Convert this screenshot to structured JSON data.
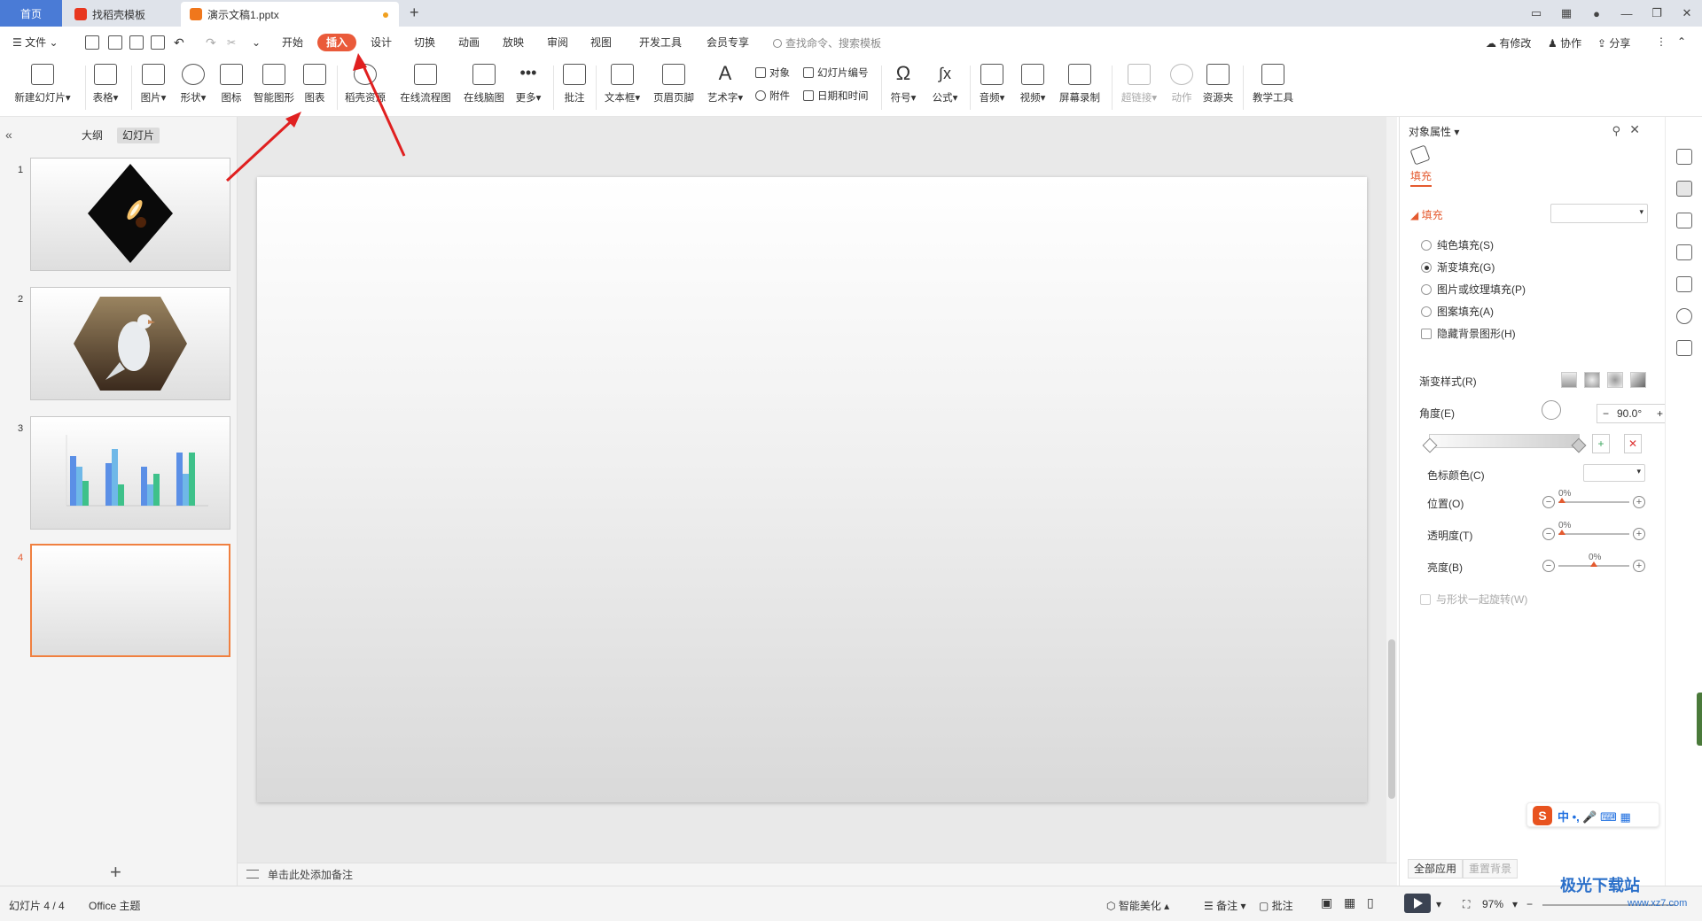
{
  "tabs": {
    "home": "首页",
    "template": "找稻壳模板",
    "doc": "演示文稿1.pptx",
    "new_tab": "+"
  },
  "menu": {
    "file": "文件",
    "items": [
      "开始",
      "插入",
      "设计",
      "切换",
      "动画",
      "放映",
      "审阅",
      "视图",
      "开发工具",
      "会员专享"
    ],
    "active_item": "插入",
    "search_placeholder": "查找命令、搜索模板",
    "changes": "有修改",
    "collab": "协作",
    "share": "分享"
  },
  "ribbon": {
    "new_slide": "新建幻灯片",
    "table": "表格",
    "picture": "图片",
    "shape": "形状",
    "icon": "图标",
    "smartart": "智能图形",
    "chart": "图表",
    "docer_resource": "稻壳资源",
    "online_flowchart": "在线流程图",
    "online_mindmap": "在线脑图",
    "more": "更多",
    "comment": "批注",
    "textbox": "文本框",
    "header_footer": "页眉页脚",
    "wordart": "艺术字",
    "object": "对象",
    "slide_number": "幻灯片编号",
    "attachment": "附件",
    "date_time": "日期和时间",
    "symbol": "符号",
    "formula": "公式",
    "audio": "音频",
    "video": "视频",
    "screen_record": "屏幕录制",
    "hyperlink": "超链接",
    "action": "动作",
    "resource_folder": "资源夹",
    "teaching_tools": "教学工具"
  },
  "left_pane": {
    "outline_tab": "大纲",
    "slides_tab": "幻灯片",
    "slide_numbers": [
      "1",
      "2",
      "3",
      "4"
    ],
    "current_slide": "4",
    "add_slide": "+"
  },
  "notes": {
    "placeholder": "单击此处添加备注"
  },
  "right_panel": {
    "title": "对象属性",
    "fill_tab": "填充",
    "fill_section": "填充",
    "options": [
      "纯色填充(S)",
      "渐变填充(G)",
      "图片或纹理填充(P)",
      "图案填充(A)"
    ],
    "selected_option": "渐变填充(G)",
    "hide_bg": "隐藏背景图形(H)",
    "gradient_style": "渐变样式(R)",
    "angle_label": "角度(E)",
    "angle_value": "90.0°",
    "stop_color": "色标颜色(C)",
    "position_label": "位置(O)",
    "position_value": "0%",
    "transparency_label": "透明度(T)",
    "transparency_value": "0%",
    "brightness_label": "亮度(B)",
    "brightness_value": "0%",
    "rotate_with_shape": "与形状一起旋转(W)",
    "apply_all": "全部应用",
    "reset_bg": "重置背景"
  },
  "status": {
    "slide_counter": "幻灯片 4 / 4",
    "theme": "Office 主题",
    "smart_beautify": "智能美化",
    "notes_btn": "备注",
    "comment_btn": "批注",
    "zoom": "97%"
  },
  "ime": {
    "logo": "S",
    "text": "中 •, 🎤 ⌨ ▦"
  },
  "watermark": {
    "line1": "极光下载站",
    "line2": "www.xz7.com"
  },
  "colors": {
    "accent": "#ea5a3a",
    "home_tab": "#4a7bd6",
    "annotation_arrow": "#e02020"
  }
}
